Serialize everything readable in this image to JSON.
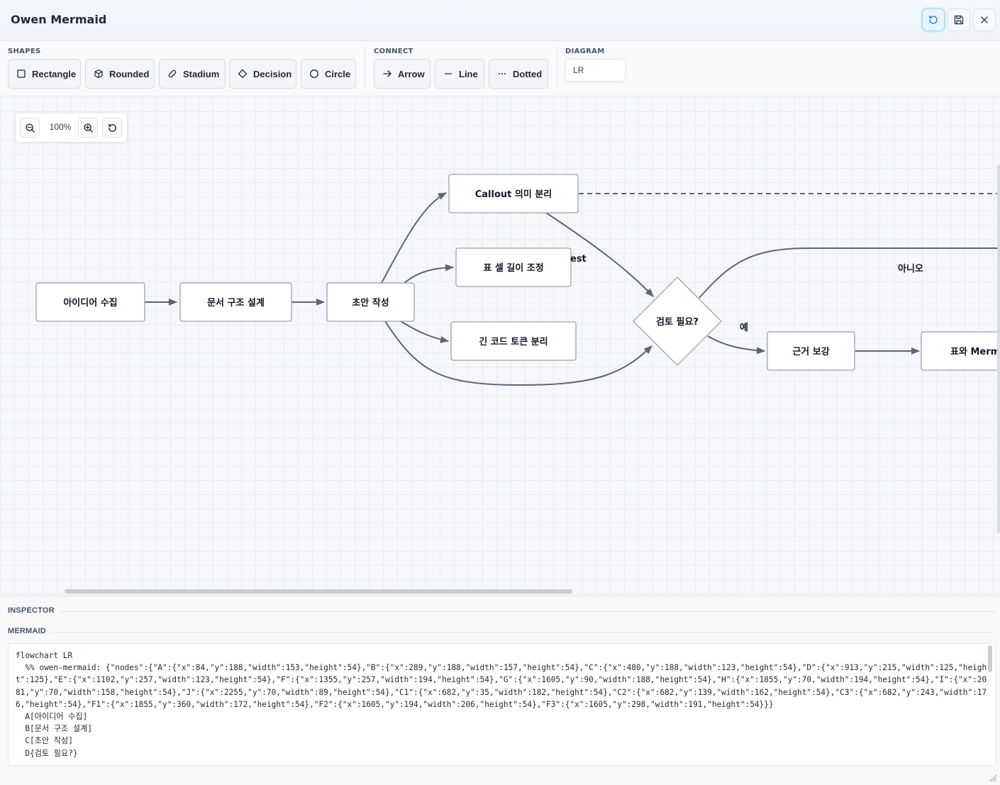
{
  "app": {
    "title": "Owen Mermaid"
  },
  "header_buttons": [
    {
      "name": "refresh-icon"
    },
    {
      "name": "save-icon"
    },
    {
      "name": "close-icon"
    }
  ],
  "toolbar": {
    "shapes_label": "SHAPES",
    "connect_label": "CONNECT",
    "diagram_label": "DIAGRAM",
    "shapes": [
      {
        "label": "Rectangle",
        "icon": "square-icon"
      },
      {
        "label": "Rounded",
        "icon": "cube-icon"
      },
      {
        "label": "Stadium",
        "icon": "pill-icon"
      },
      {
        "label": "Decision",
        "icon": "diamond-icon"
      },
      {
        "label": "Circle",
        "icon": "circle-icon"
      }
    ],
    "connect": [
      {
        "label": "Arrow",
        "icon": "arrow-right-icon"
      },
      {
        "label": "Line",
        "icon": "line-icon"
      },
      {
        "label": "Dotted",
        "icon": "dots-icon"
      }
    ],
    "direction": "LR"
  },
  "zoom": {
    "level": "100%"
  },
  "diagram": {
    "nodes": {
      "A": "아이디어 수집",
      "B": "문서 구조 설계",
      "C": "초안 작성",
      "D": "검토 필요?",
      "C1": "Callout 의미 분리",
      "C2": "표 셀 길이 조정",
      "C3": "긴 코드 토큰 분리",
      "E": "근거 보강",
      "F": "표와 Merm"
    },
    "edge_labels": {
      "no": "아니오",
      "yes": "예",
      "partial": "est"
    },
    "colors": {
      "edge": "#5b6575",
      "node_border": "#9aa3ae",
      "node_fill": "#ffffff"
    }
  },
  "inspector": {
    "inspector_label": "INSPECTOR",
    "mermaid_label": "MERMAID",
    "code": "flowchart LR\n  %% owen-mermaid: {\"nodes\":{\"A\":{\"x\":84,\"y\":188,\"width\":153,\"height\":54},\"B\":{\"x\":289,\"y\":188,\"width\":157,\"height\":54},\"C\":{\"x\":480,\"y\":188,\"width\":123,\"height\":54},\"D\":{\"x\":913,\"y\":215,\"width\":125,\"height\":125},\"E\":{\"x\":1102,\"y\":257,\"width\":123,\"height\":54},\"F\":{\"x\":1355,\"y\":257,\"width\":194,\"height\":54},\"G\":{\"x\":1605,\"y\":90,\"width\":188,\"height\":54},\"H\":{\"x\":1855,\"y\":70,\"width\":194,\"height\":54},\"I\":{\"x\":2081,\"y\":70,\"width\":158,\"height\":54},\"J\":{\"x\":2255,\"y\":70,\"width\":89,\"height\":54},\"C1\":{\"x\":682,\"y\":35,\"width\":182,\"height\":54},\"C2\":{\"x\":682,\"y\":139,\"width\":162,\"height\":54},\"C3\":{\"x\":682,\"y\":243,\"width\":176,\"height\":54},\"F1\":{\"x\":1855,\"y\":360,\"width\":172,\"height\":54},\"F2\":{\"x\":1605,\"y\":194,\"width\":206,\"height\":54},\"F3\":{\"x\":1605,\"y\":298,\"width\":191,\"height\":54}}}\n  A[아이디어 수집]\n  B[문서 구조 설계]\n  C[초안 작성]\n  D{검토 필요?}"
  }
}
